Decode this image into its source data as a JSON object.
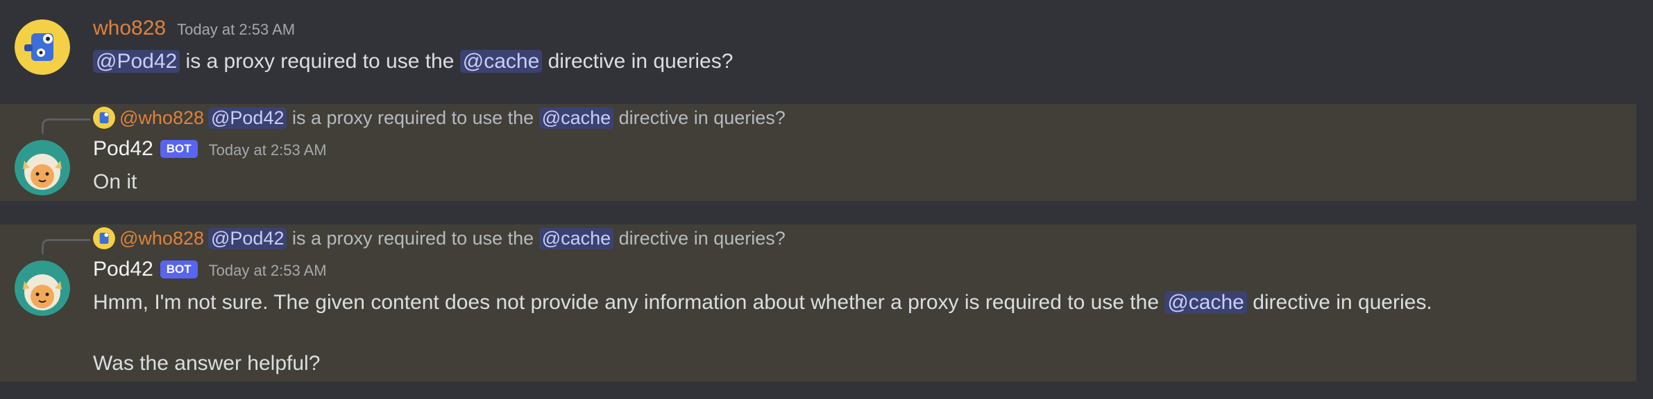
{
  "messages": [
    {
      "author": "who828",
      "timestamp": "Today at 2:53 AM",
      "content": {
        "mention1": "@Pod42",
        "text1": " is a proxy required to use the ",
        "mention2": "@cache",
        "text2": " directive in queries?"
      }
    },
    {
      "reply": {
        "author": "@who828",
        "mention1": "@Pod42",
        "text1": " is a proxy required to use the ",
        "mention2": "@cache",
        "text2": " directive in queries?"
      },
      "author": "Pod42",
      "badge": "BOT",
      "timestamp": "Today at 2:53 AM",
      "content": {
        "text": "On it"
      }
    },
    {
      "reply": {
        "author": "@who828",
        "mention1": "@Pod42",
        "text1": " is a proxy required to use the ",
        "mention2": "@cache",
        "text2": " directive in queries?"
      },
      "author": "Pod42",
      "badge": "BOT",
      "timestamp": "Today at 2:53 AM",
      "content": {
        "text1": "Hmm, I'm not sure. The given content does not provide any information about whether a proxy is required to use the ",
        "mention": "@cache",
        "text2": " directive in queries.",
        "line2": "Was the answer helpful?"
      }
    }
  ],
  "colors": {
    "background": "#313338",
    "highlight": "#413f37",
    "username_user": "#e0813d",
    "bot_badge": "#5865f2",
    "mention_bg": "#3c4270"
  }
}
